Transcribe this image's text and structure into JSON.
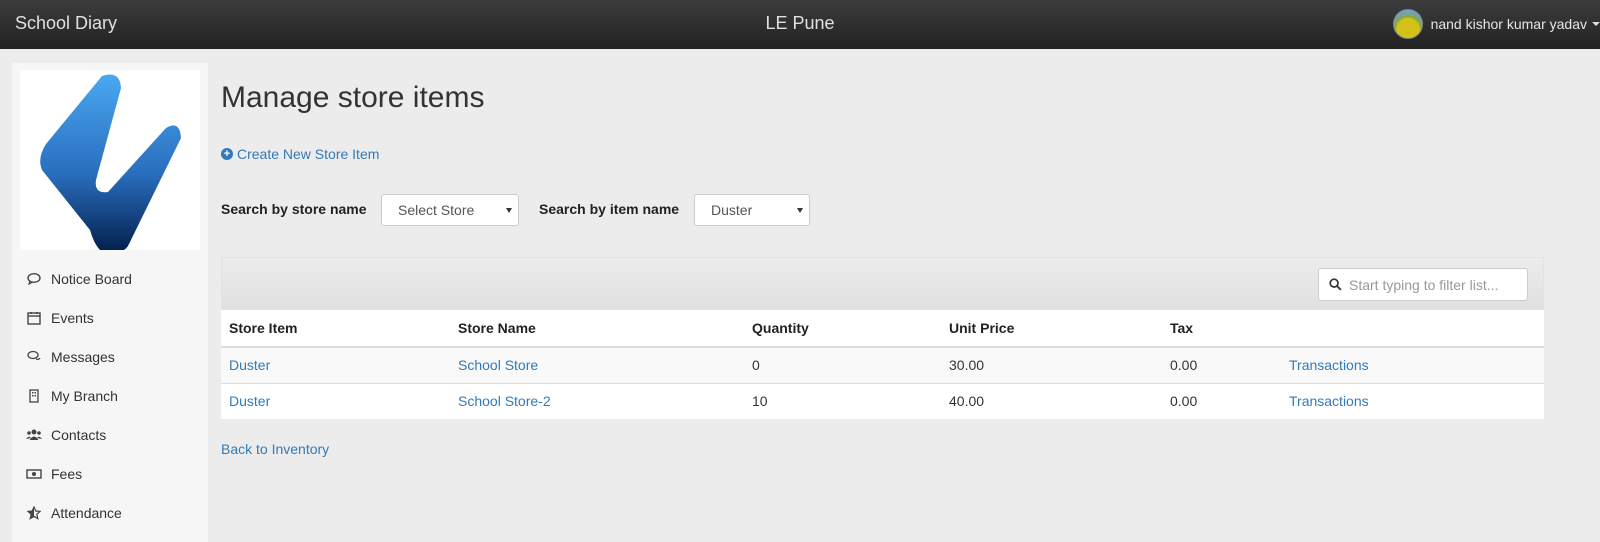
{
  "navbar": {
    "brand": "School Diary",
    "school": "LE Pune",
    "user_name": "nand kishor kumar yadav"
  },
  "sidebar": {
    "items": [
      {
        "label": "Notice Board",
        "icon": "comment-icon"
      },
      {
        "label": "Events",
        "icon": "calendar-icon"
      },
      {
        "label": "Messages",
        "icon": "chat-icon"
      },
      {
        "label": "My Branch",
        "icon": "building-icon"
      },
      {
        "label": "Contacts",
        "icon": "users-icon"
      },
      {
        "label": "Fees",
        "icon": "money-icon"
      },
      {
        "label": "Attendance",
        "icon": "star-half-icon"
      }
    ]
  },
  "main": {
    "title": "Manage store items",
    "create_label": "Create New Store Item",
    "filters": {
      "store_label": "Search by store name",
      "store_value": "Select Store",
      "item_label": "Search by item name",
      "item_value": "Duster"
    },
    "filter_placeholder": "Start typing to filter list...",
    "table": {
      "headers": [
        "Store Item",
        "Store Name",
        "Quantity",
        "Unit Price",
        "Tax",
        ""
      ],
      "rows": [
        {
          "item": "Duster",
          "store": "School Store",
          "quantity": "0",
          "unit_price": "30.00",
          "tax": "0.00",
          "action": "Transactions"
        },
        {
          "item": "Duster",
          "store": "School Store-2",
          "quantity": "10",
          "unit_price": "40.00",
          "tax": "0.00",
          "action": "Transactions"
        }
      ]
    },
    "back_label": "Back to Inventory"
  },
  "colors": {
    "link": "#337ab7",
    "navbar": "#2b2b2b",
    "background": "#ececec",
    "logo_gradient_top": "#4aa8f0",
    "logo_gradient_bottom": "#0a2a5a"
  }
}
